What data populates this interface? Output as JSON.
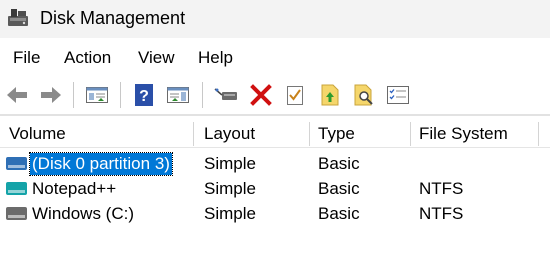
{
  "window": {
    "title": "Disk Management",
    "icon": "disk-management-icon"
  },
  "menu": [
    "File",
    "Action",
    "View",
    "Help"
  ],
  "toolbar": {
    "icons": [
      "back-arrow-icon",
      "forward-arrow-icon",
      "console-tree-icon",
      "help-icon",
      "action-pane-icon",
      "connect-drive-icon",
      "delete-icon",
      "properties-icon",
      "export-icon",
      "search-icon",
      "list-view-icon"
    ]
  },
  "table": {
    "columns": [
      "Volume",
      "Layout",
      "Type",
      "File System"
    ],
    "rows": [
      {
        "volume": "(Disk 0 partition 3)",
        "layout": "Simple",
        "type": "Basic",
        "fs": "",
        "icon_color": "#2f6fb5",
        "selected": true
      },
      {
        "volume": "Notepad++",
        "layout": "Simple",
        "type": "Basic",
        "fs": "NTFS",
        "icon_color": "#14a3a8",
        "selected": false
      },
      {
        "volume": "Windows (C:)",
        "layout": "Simple",
        "type": "Basic",
        "fs": "NTFS",
        "icon_color": "#6b6b6b",
        "selected": false
      }
    ]
  },
  "colors": {
    "selection": "#0078d7",
    "titlebar": "#f3f3f3"
  }
}
